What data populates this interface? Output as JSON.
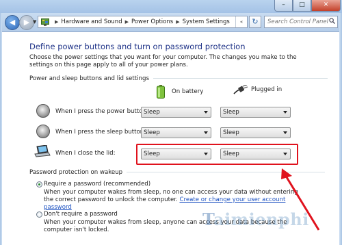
{
  "window": {
    "minimize": "–",
    "maximize": "□",
    "close": "✕"
  },
  "nav": {
    "back_icon": "arrow-left-icon",
    "forward_icon": "arrow-right-icon",
    "breadcrumb": [
      "Hardware and Sound",
      "Power Options",
      "System Settings"
    ],
    "overflow": "«",
    "search_placeholder": "Search Control Panel"
  },
  "page": {
    "title": "Define power buttons and turn on password protection",
    "intro": "Choose the power settings that you want for your computer. The changes you make to the settings on this page apply to all of your power plans."
  },
  "buttons_section": {
    "heading": "Power and sleep buttons and lid settings",
    "col_battery": "On battery",
    "col_plugged": "Plugged in",
    "rows": [
      {
        "label": "When I press the power button:",
        "battery": "Sleep",
        "plugged": "Sleep"
      },
      {
        "label": "When I press the sleep button:",
        "battery": "Sleep",
        "plugged": "Sleep"
      },
      {
        "label": "When I close the lid:",
        "battery": "Sleep",
        "plugged": "Sleep"
      }
    ]
  },
  "password_section": {
    "heading": "Password protection on wakeup",
    "opt1_title": "Require a password (recommended)",
    "opt1_desc": "When your computer wakes from sleep, no one can access your data without entering the correct password to unlock the computer.",
    "opt1_link": "Create or change your user account password",
    "opt2_title": "Don't require a password",
    "opt2_desc": "When your computer wakes from sleep, anyone can access your data because the computer isn't locked.",
    "selected": 1
  },
  "watermark": {
    "part1": "T",
    "part2": "aimienphi"
  },
  "annotation": {
    "highlight_color": "#e0121d"
  }
}
